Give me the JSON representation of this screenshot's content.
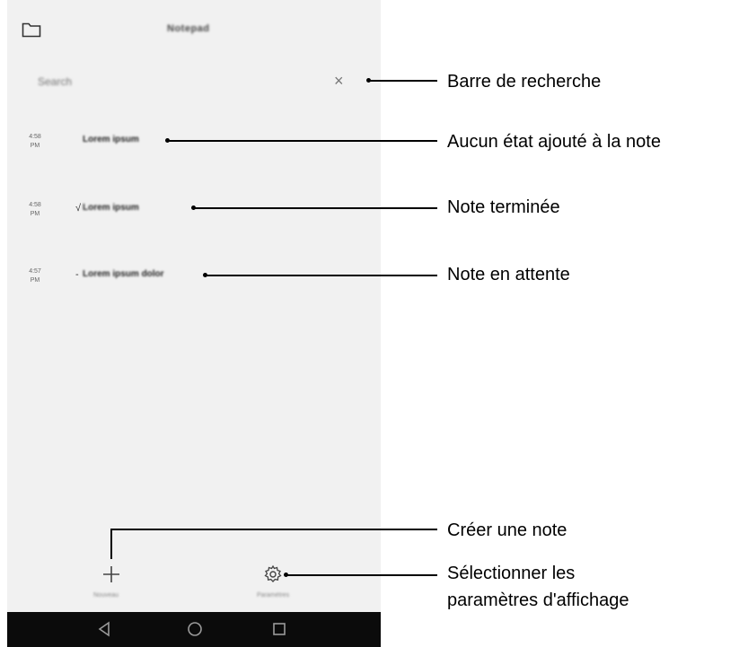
{
  "app": {
    "title": "Notepad"
  },
  "search": {
    "placeholder": "Search",
    "clear_symbol": "×"
  },
  "notes": [
    {
      "time_line1": "4:58",
      "time_line2": "PM",
      "status": "",
      "title": "Lorem ipsum"
    },
    {
      "time_line1": "4:58",
      "time_line2": "PM",
      "status": "√",
      "title": "Lorem ipsum"
    },
    {
      "time_line1": "4:57",
      "time_line2": "PM",
      "status": "-",
      "title": "Lorem ipsum dolor"
    }
  ],
  "actions": {
    "add_label": "Nouveau",
    "settings_label": "Paramètres"
  },
  "callouts": {
    "search": "Barre de recherche",
    "no_state": "Aucun état ajouté à la note",
    "done": "Note terminée",
    "pending": "Note en attente",
    "create": "Créer une note",
    "settings_line1": "Sélectionner les",
    "settings_line2": "paramètres d'affichage"
  },
  "icons": {
    "folder": "folder-icon",
    "clear": "close-icon",
    "add": "plus-icon",
    "settings": "gear-icon",
    "back": "back-icon",
    "home": "home-icon",
    "recents": "recents-icon"
  }
}
